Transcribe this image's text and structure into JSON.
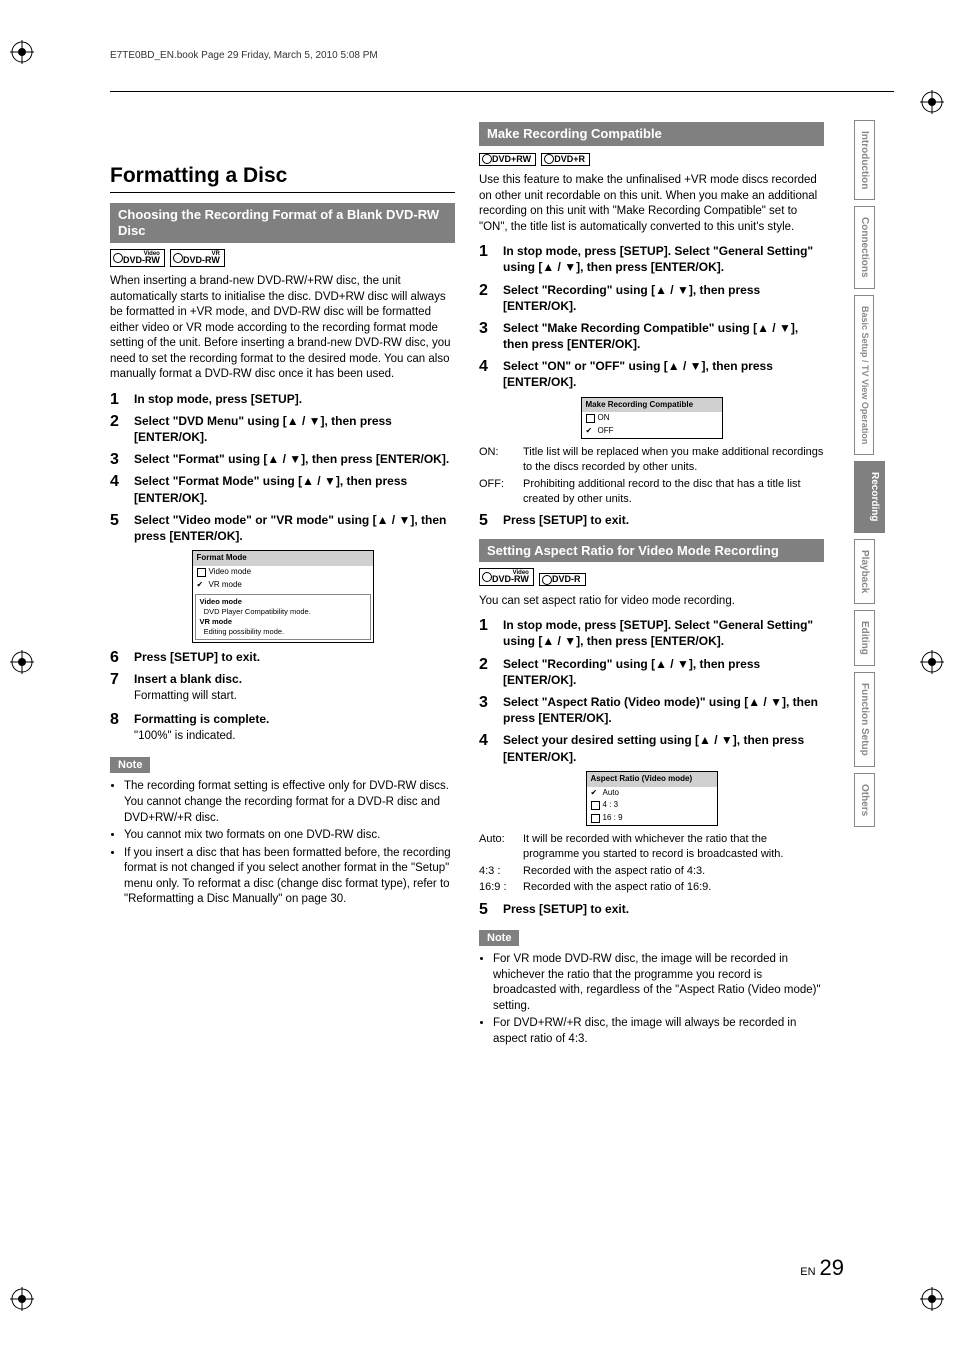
{
  "header": "E7TE0BD_EN.book  Page 29  Friday, March 5, 2010  5:08 PM",
  "page_label_prefix": "EN",
  "page_number": "29",
  "side_tabs": [
    "Introduction",
    "Connections",
    "Basic Setup / TV View Operation",
    "Recording",
    "Playback",
    "Editing",
    "Function Setup",
    "Others"
  ],
  "left": {
    "title": "Formatting a Disc",
    "sub1": "Choosing the Recording Format of a Blank DVD-RW Disc",
    "badges": [
      {
        "sup": "Video",
        "main": "DVD-RW"
      },
      {
        "sup": "VR",
        "main": "DVD-RW"
      }
    ],
    "intro": "When inserting a brand-new DVD-RW/+RW disc, the unit automatically starts to initialise the disc. DVD+RW disc will always be formatted in +VR mode, and DVD-RW disc will be formatted either video or VR mode according to the recording format mode setting of the unit. Before inserting a brand-new DVD-RW disc, you need to set the recording format to the desired mode. You can also manually format a DVD-RW disc once it has been used.",
    "steps": [
      "In stop mode, press [SETUP].",
      "Select \"DVD Menu\" using [▲ / ▼], then press [ENTER/OK].",
      "Select \"Format\" using [▲ / ▼], then press [ENTER/OK].",
      "Select \"Format Mode\" using [▲ / ▼], then press [ENTER/OK].",
      "Select \"Video mode\" or \"VR mode\" using [▲ / ▼], then press [ENTER/OK]."
    ],
    "menu": {
      "title": "Format Mode",
      "rows": [
        {
          "label": "Video mode",
          "checked": false
        },
        {
          "label": "VR mode",
          "checked": true
        }
      ],
      "inner": [
        {
          "b": "Video mode",
          "t": "DVD Player Compatibility mode."
        },
        {
          "b": "VR mode",
          "t": "Editing possibility mode."
        }
      ]
    },
    "steps2": [
      {
        "main": "Press [SETUP] to exit."
      },
      {
        "main": "Insert a blank disc.",
        "sub": "Formatting will start."
      },
      {
        "main": "Formatting is complete.",
        "sub": "\"100%\" is indicated."
      }
    ],
    "note_label": "Note",
    "notes": [
      "The recording format setting is effective only for DVD-RW discs. You cannot change the recording format for a DVD-R disc and DVD+RW/+R disc.",
      "You cannot mix two formats on one DVD-RW disc.",
      "If you insert a disc that has been formatted before, the recording format is not changed if you select another format in the \"Setup\" menu only. To reformat a disc (change disc format type), refer to \"Reformatting a Disc Manually\" on page 30."
    ]
  },
  "right": {
    "sub1": "Make Recording Compatible",
    "badges1": [
      {
        "sup": "",
        "main": "DVD+RW"
      },
      {
        "sup": "",
        "main": "DVD+R"
      }
    ],
    "intro1": "Use this feature to make the unfinalised +VR mode discs recorded on other unit recordable on this unit. When you make an additional recording on this unit with \"Make Recording Compatible\" set to \"ON\", the title list is automatically converted to this unit's style.",
    "steps1": [
      "In stop mode, press [SETUP]. Select \"General Setting\" using [▲ / ▼], then press [ENTER/OK].",
      "Select \"Recording\" using [▲ / ▼], then press [ENTER/OK].",
      "Select \"Make Recording Compatible\" using [▲ / ▼], then press [ENTER/OK].",
      "Select \"ON\" or \"OFF\" using [▲ / ▼], then press [ENTER/OK]."
    ],
    "menu1": {
      "title": "Make Recording Compatible",
      "rows": [
        {
          "label": "ON",
          "checked": false
        },
        {
          "label": "OFF",
          "checked": true
        }
      ]
    },
    "defs1": [
      {
        "k": "ON:",
        "v": "Title list will be replaced when you make additional recordings to the discs recorded by other units."
      },
      {
        "k": "OFF:",
        "v": "Prohibiting additional record to the disc that has a title list created by other units."
      }
    ],
    "step1_exit": "Press [SETUP] to exit.",
    "sub2": "Setting Aspect Ratio for Video Mode Recording",
    "badges2": [
      {
        "sup": "Video",
        "main": "DVD-RW"
      },
      {
        "sup": "",
        "main": "DVD-R"
      }
    ],
    "intro2": "You can set aspect ratio for video mode recording.",
    "steps2": [
      "In stop mode, press [SETUP]. Select \"General Setting\" using [▲ / ▼], then press [ENTER/OK].",
      "Select \"Recording\" using [▲ / ▼], then press [ENTER/OK].",
      "Select \"Aspect Ratio (Video mode)\" using [▲ / ▼], then press [ENTER/OK].",
      "Select your desired setting using [▲ / ▼], then press [ENTER/OK]."
    ],
    "menu2": {
      "title": "Aspect Ratio (Video mode)",
      "rows": [
        {
          "label": "Auto",
          "checked": true
        },
        {
          "label": "4 : 3",
          "checked": false
        },
        {
          "label": "16 : 9",
          "checked": false
        }
      ]
    },
    "defs2": [
      {
        "k": "Auto:",
        "v": "It will be recorded with whichever the ratio that the programme you started to record is broadcasted with."
      },
      {
        "k": "4:3 :",
        "v": "Recorded with the aspect ratio of 4:3."
      },
      {
        "k": "16:9 :",
        "v": "Recorded with the aspect ratio of 16:9."
      }
    ],
    "step2_exit": "Press [SETUP] to exit.",
    "note_label": "Note",
    "notes2": [
      "For VR mode DVD-RW disc, the image will be recorded in whichever the ratio that the programme you record is broadcasted with, regardless of the \"Aspect Ratio (Video mode)\" setting.",
      "For DVD+RW/+R disc, the image will always be recorded in aspect ratio of 4:3."
    ]
  }
}
